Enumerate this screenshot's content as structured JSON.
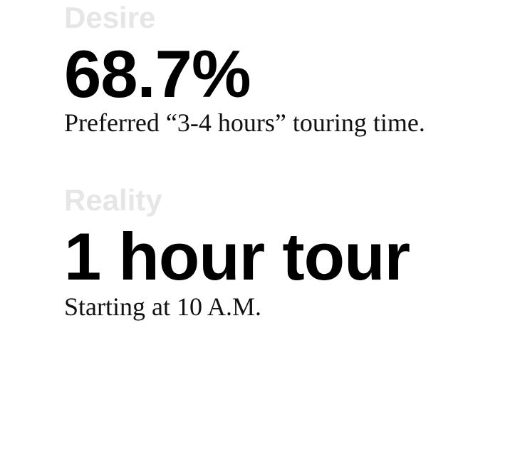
{
  "colors": {
    "label": "#e6e6e6",
    "value": "#000000",
    "note": "#111111",
    "background": "#ffffff"
  },
  "desire": {
    "label": "Desire",
    "value": "68.7%",
    "note": "Preferred “3-4 hours” touring time."
  },
  "reality": {
    "label": "Reality",
    "value": "1 hour tour",
    "note": "Starting at 10 A.M."
  }
}
